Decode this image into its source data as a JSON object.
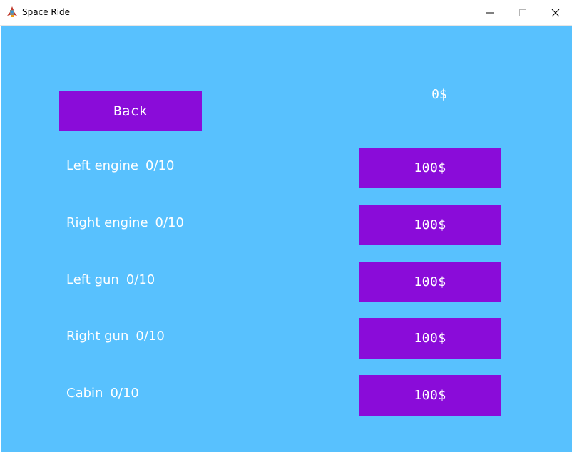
{
  "window": {
    "title": "Space Ride",
    "icon": "spaceship-icon",
    "controls": [
      "minimize-icon",
      "maximize-icon",
      "close-icon"
    ]
  },
  "colors": {
    "background": "#58c1fe",
    "button": "#8a0cd9",
    "text": "#ffffff"
  },
  "back_label": "Back",
  "money": "0$",
  "upgrades": [
    {
      "name": "Left engine",
      "level": "0/10",
      "price": "100$"
    },
    {
      "name": "Right engine",
      "level": "0/10",
      "price": "100$"
    },
    {
      "name": "Left gun",
      "level": "0/10",
      "price": "100$"
    },
    {
      "name": "Right gun",
      "level": "0/10",
      "price": "100$"
    },
    {
      "name": "Cabin",
      "level": "0/10",
      "price": "100$"
    }
  ]
}
